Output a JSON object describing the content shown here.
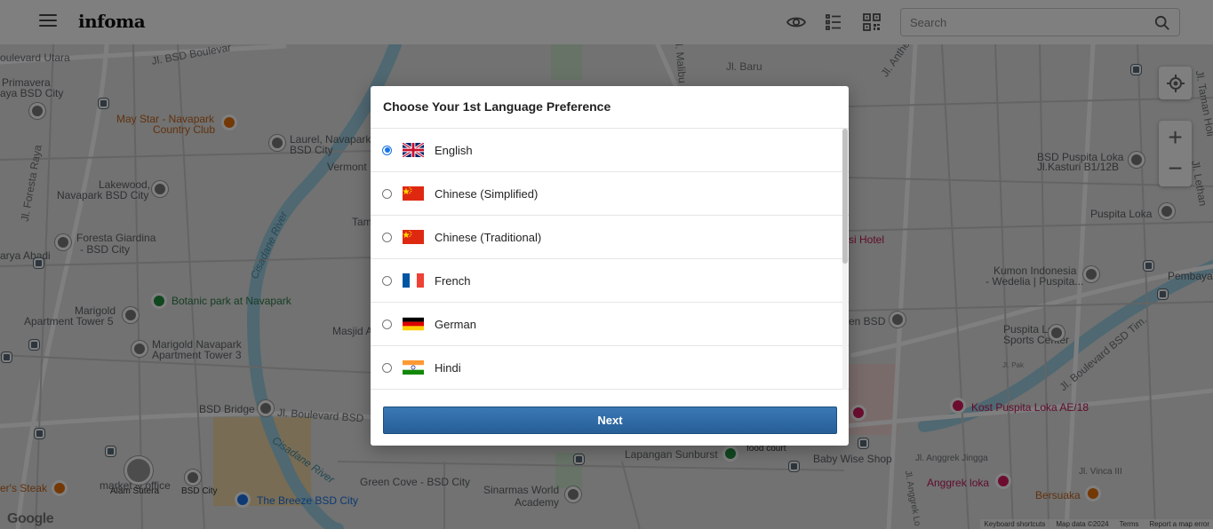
{
  "app": {
    "logo_text": "infoma"
  },
  "header": {
    "search_placeholder": "Search",
    "icons": [
      "menu-icon",
      "eye-icon",
      "list-icon",
      "qr-code-icon",
      "search-icon"
    ]
  },
  "modal": {
    "title": "Choose Your 1st Language Preference",
    "selected_language": "English",
    "languages": [
      {
        "label": "English",
        "flag": "uk-flag-icon",
        "checked": true
      },
      {
        "label": "Chinese (Simplified)",
        "flag": "china-flag-icon",
        "checked": false
      },
      {
        "label": "Chinese (Traditional)",
        "flag": "china-flag-icon",
        "checked": false
      },
      {
        "label": "French",
        "flag": "france-flag-icon",
        "checked": false
      },
      {
        "label": "German",
        "flag": "germany-flag-icon",
        "checked": false
      },
      {
        "label": "Hindi",
        "flag": "india-flag-icon",
        "checked": false
      }
    ],
    "next_label": "Next"
  },
  "map": {
    "labels": {
      "boulevard_utara": "oulevard Utara",
      "jl_bsd_boulevard": "Jl. BSD Boulevar",
      "primavera": "Primavera",
      "primavera2": "aya BSD City",
      "may_star": "May Star - Navapark",
      "may_star2": "Country Club",
      "laurel": "Laurel, Navapark",
      "laurel2": "BSD City",
      "vermont": "Vermont",
      "lakewood": "Lakewood,",
      "lakewood2": "Navapark BSD City",
      "jl_foresta_raya": "Jl. Foresta Raya",
      "cisadane_river1": "Cisadane River",
      "foresta_giardina": "Foresta Giardina",
      "foresta_giardina2": "- BSD City",
      "arya_abadi": "arya Abadi",
      "botanic": "Botanic park at Navapark",
      "marigold5": "Marigold",
      "marigold5b": "Apartment Tower 5",
      "masjid": "Masjid A",
      "tam": "Tam",
      "marigold3": "Marigold Navapark",
      "marigold3b": "Apartment Tower 3",
      "bsd_bridge": "BSD Bridge",
      "jl_boulevard_bsd": "Jl. Boulevard BSD",
      "cisadane_river2": "Cisadane River",
      "alam_sutera": "Alam Sutera",
      "bsd_city": "BSD City",
      "markets_office": "market & office",
      "rs_steak": "er's Steak",
      "the_breeze": "The Breeze BSD City",
      "green_cove": "Green Cove - BSD City",
      "sinarmas": "Sinarmas World",
      "sinarmas2": "Academy",
      "lapangan_sunburst": "Lapangan Sunburst",
      "food_court": "food court",
      "baby_wise": "Baby Wise Shop",
      "jl_baru": "Jl. Baru",
      "jl_anthe": "Jl. Anthe",
      "jl_malibu": "Jl. Malibu",
      "bsd_puspita_loka": "BSD Puspita Loka",
      "bsd_puspita_loka2": "Jl.Kasturi B1/12B",
      "puspita_loka": "Puspita Loka",
      "kumon": "Kumon Indonesia",
      "kumon2": "- Wedelia | Puspita...",
      "si_hotel": "si Hotel",
      "en_bsd": "en BSD",
      "puspita_loka_sports": "Puspita Loka",
      "puspita_loka_sports2": "Sports Center",
      "jl_boulevard_bsd_tim": "Jl. Boulevard BSD Tim.",
      "kost_puspita": "Kost Puspita Loka AE/18",
      "jl_anggrek_jingga": "Jl. Anggrek Jingga",
      "anggrek_loka": "Anggrek loka",
      "bersuaka": "Bersuaka",
      "jl_vinca_iii": "Jl. Vinca III",
      "jl_anggrek_lo": "Jl. Anggrek Lo",
      "pembaya": "Pembaya",
      "jl_lethan": "Jl. Lethan",
      "jl_taman": "Jl. Taman Holi",
      "ingstyle": "Jl. Pak"
    },
    "attribution": [
      "Keyboard shortcuts",
      "Map data ©2024",
      "Terms",
      "Report a map error"
    ],
    "google": "Google"
  }
}
